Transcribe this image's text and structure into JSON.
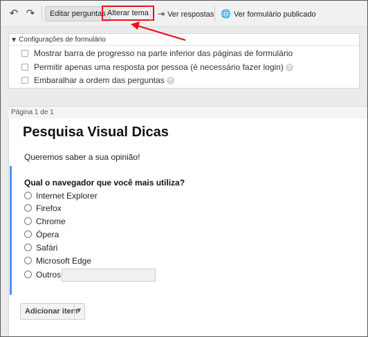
{
  "toolbar": {
    "undo_icon": "undo-icon",
    "redo_icon": "redo-icon",
    "edit_questions": "Editar perguntas",
    "change_theme": "Alterar tema",
    "view_responses": "Ver respostas",
    "view_published": "Ver formulário publicado"
  },
  "config": {
    "title": "Configurações de formulário",
    "options": [
      {
        "label": "Mostrar barra de progresso na parte inferior das páginas de formulário",
        "checked": false,
        "help": false
      },
      {
        "label": "Permitir apenas uma resposta por pessoa (é necessário fazer login)",
        "checked": false,
        "help": true
      },
      {
        "label": "Embaralhar a ordem das perguntas",
        "checked": false,
        "help": true
      }
    ],
    "help_glyph": "?"
  },
  "page": {
    "label": "Página 1 de 1"
  },
  "form": {
    "title": "Pesquisa Visual Dicas",
    "description": "Queremos saber a sua opinião!",
    "question": "Qual o navegador que você mais utiliza?",
    "choices": [
      "Internet Explorer",
      "Firefox",
      "Chrome",
      "Ópera",
      "Safári",
      "Microsoft Edge",
      "Outros:"
    ],
    "add_item": "Adicionar item"
  },
  "colors": {
    "highlight": "#e8101a",
    "question_accent": "#4d90fe"
  }
}
